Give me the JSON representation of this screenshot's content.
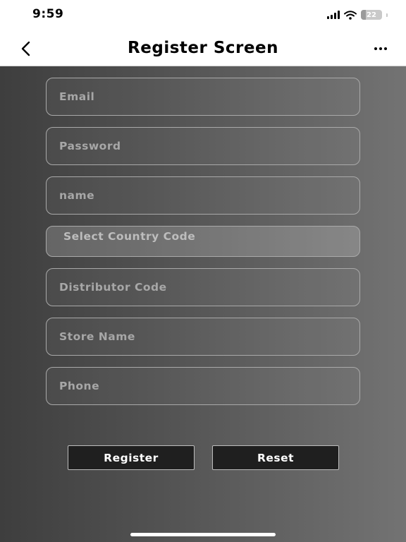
{
  "status_bar": {
    "time": "9:59",
    "battery_percent": 22,
    "battery_label": "22"
  },
  "nav": {
    "title": "Register Screen"
  },
  "form": {
    "email_placeholder": "Email",
    "password_placeholder": "Password",
    "name_placeholder": "name",
    "country_code_label": "Select Country Code",
    "distributor_code_placeholder": "Distributor Code",
    "store_name_placeholder": "Store Name",
    "phone_placeholder": "Phone"
  },
  "actions": {
    "register_label": "Register",
    "reset_label": "Reset"
  },
  "colors": {
    "button_background": "#1f1f1f",
    "field_border": "#a9a9a9"
  }
}
